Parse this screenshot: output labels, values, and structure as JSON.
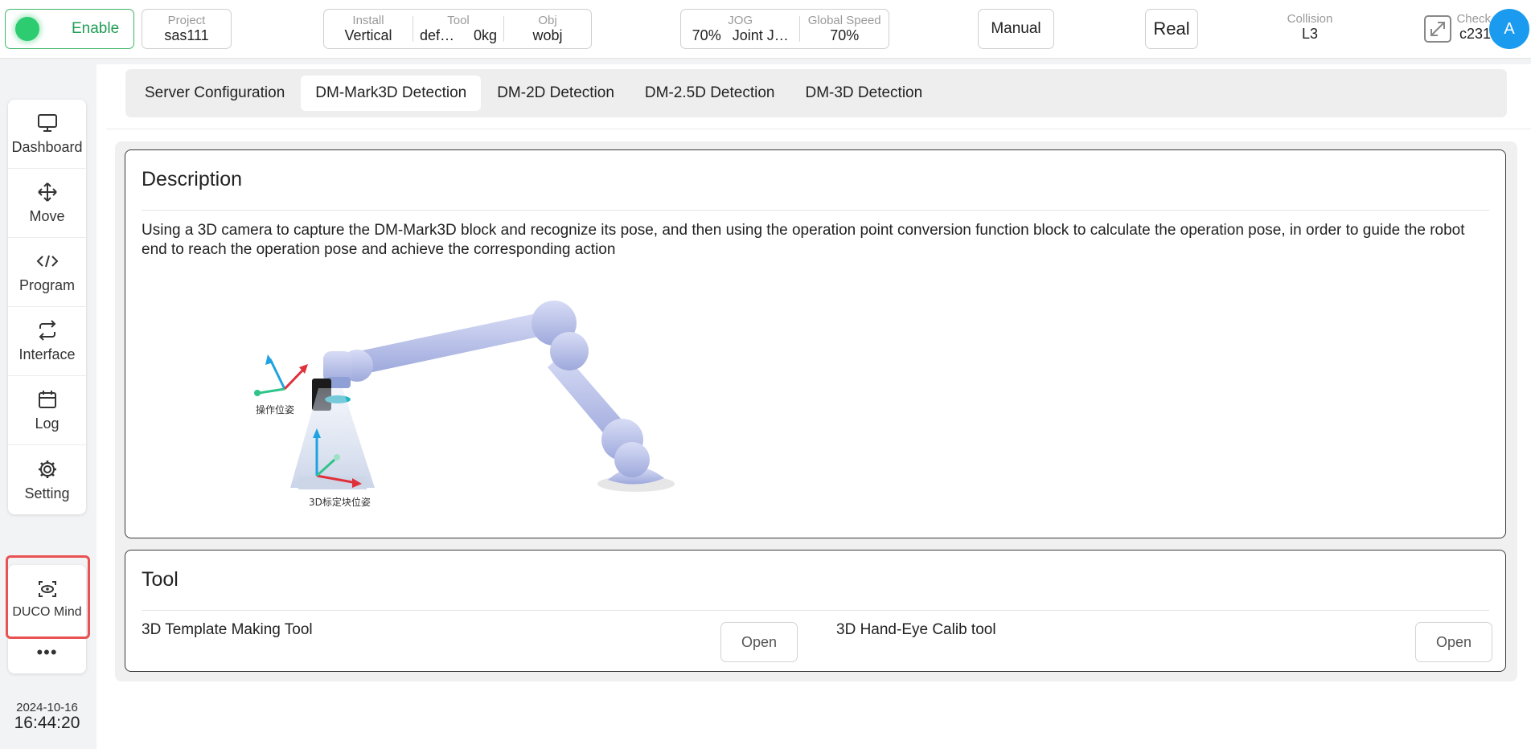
{
  "topbar": {
    "enable_label": "Enable",
    "project": {
      "label": "Project",
      "value": "sas111"
    },
    "install": {
      "label": "Install",
      "value": "Vertical"
    },
    "tool": {
      "label": "Tool",
      "value_name": "def…",
      "value_load": "0kg"
    },
    "obj": {
      "label": "Obj",
      "value": "wobj"
    },
    "jog": {
      "label": "JOG",
      "value_pct": "70%",
      "value_mode": "Joint J…"
    },
    "global_speed": {
      "label": "Global Speed",
      "value": "70%"
    },
    "manual_label": "Manual",
    "real_label": "Real",
    "collision": {
      "label": "Collision",
      "value": "L3"
    },
    "check": {
      "label": "Check",
      "value": "c231"
    },
    "avatar_letter": "A"
  },
  "sidebar": {
    "items": [
      {
        "label": "Dashboard",
        "icon": "monitor-icon"
      },
      {
        "label": "Move",
        "icon": "move-arrows-icon"
      },
      {
        "label": "Program",
        "icon": "code-icon"
      },
      {
        "label": "Interface",
        "icon": "swap-icon"
      },
      {
        "label": "Log",
        "icon": "calendar-icon"
      },
      {
        "label": "Setting",
        "icon": "gear-icon"
      }
    ],
    "duco_mind_label": "DUCO Mind",
    "more_label": "•••",
    "date": "2024-10-16",
    "time": "16:44:20"
  },
  "tabs": [
    {
      "label": "Server Configuration",
      "active": false
    },
    {
      "label": "DM-Mark3D Detection",
      "active": true
    },
    {
      "label": "DM-2D Detection",
      "active": false
    },
    {
      "label": "DM-2.5D Detection",
      "active": false
    },
    {
      "label": "DM-3D Detection",
      "active": false
    }
  ],
  "description": {
    "title": "Description",
    "text": "Using a 3D camera to capture the DM-Mark3D block and recognize its pose, and then using the operation point conversion function block to calculate the operation pose, in order to guide the robot end to reach the operation pose and achieve the corresponding action",
    "figure_label_operation": "操作位姿",
    "figure_label_block": "3D标定块位姿"
  },
  "tool": {
    "title": "Tool",
    "items": [
      {
        "label": "3D Template Making Tool",
        "button": "Open"
      },
      {
        "label": "3D Hand-Eye Calib tool",
        "button": "Open"
      }
    ]
  },
  "colors": {
    "accent_green": "#2ecc71",
    "avatar_blue": "#1a9bf0",
    "highlight_red": "#e85252"
  }
}
